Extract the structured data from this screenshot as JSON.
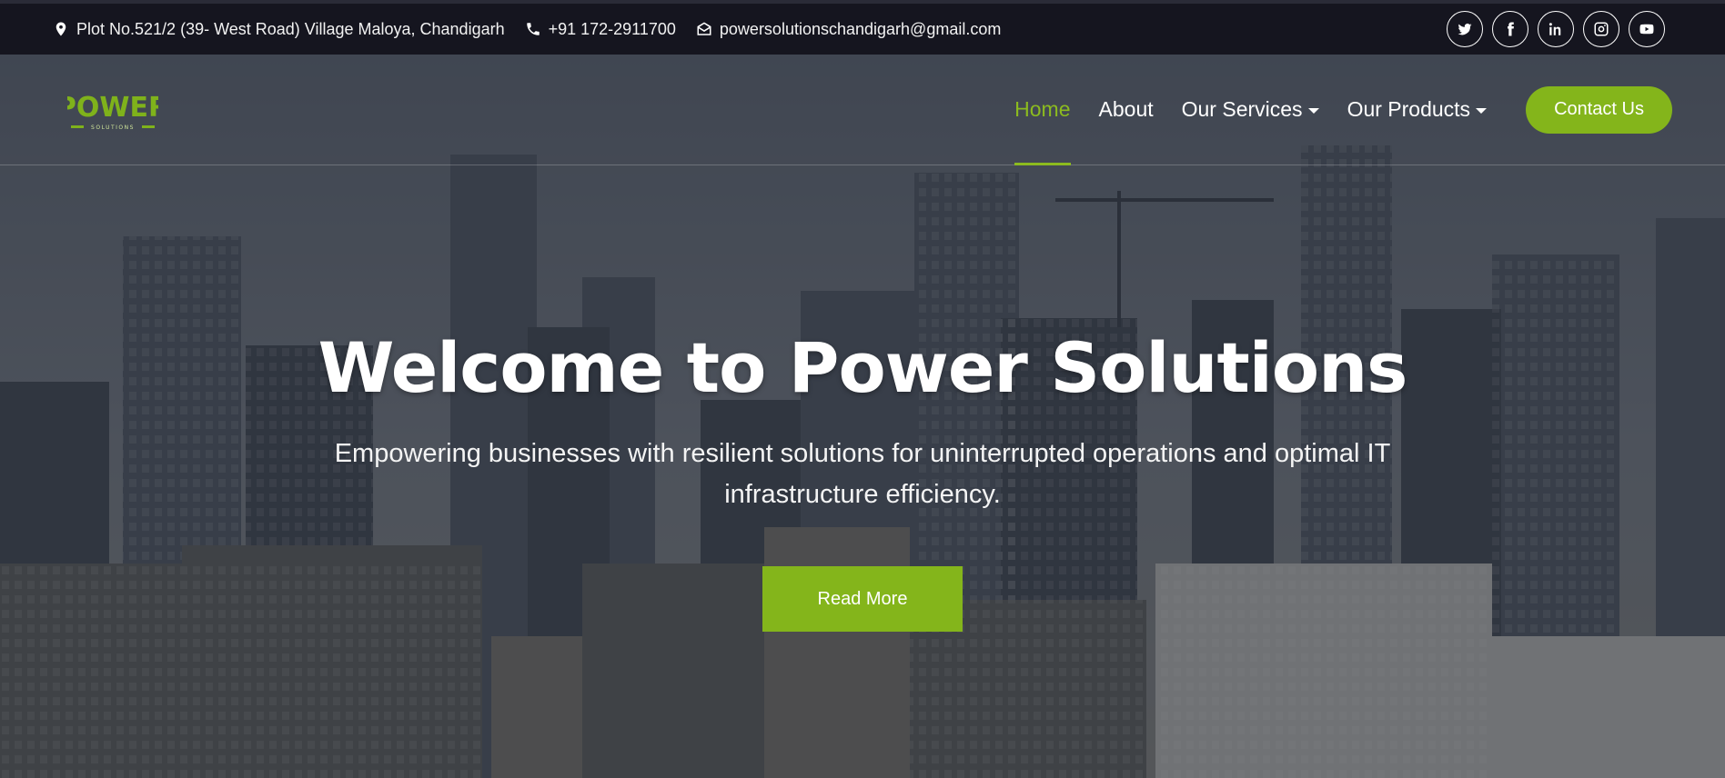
{
  "topbar": {
    "address": "Plot No.521/2 (39- West Road) Village Maloya, Chandigarh",
    "phone": "+91 172-2911700",
    "email": "powersolutionschandigarh@gmail.com",
    "icons": [
      "map-pin-icon",
      "phone-icon",
      "envelope-open-icon"
    ],
    "socials": [
      "twitter-icon",
      "facebook-icon",
      "linkedin-icon",
      "instagram-icon",
      "youtube-icon"
    ]
  },
  "logo": {
    "line1": "POWER",
    "line2": "SOLUTIONS"
  },
  "nav": {
    "items": [
      {
        "label": "Home",
        "active": true
      },
      {
        "label": "About"
      },
      {
        "label": "Our Services",
        "dropdown": true
      },
      {
        "label": "Our Products",
        "dropdown": true
      }
    ],
    "contact_label": "Contact Us"
  },
  "hero": {
    "title": "Welcome to Power Solutions",
    "subtitle": "Empowering businesses with resilient solutions for uninterrupted operations and optimal IT infrastructure efficiency.",
    "cta_label": "Read More"
  },
  "colors": {
    "accent": "#84b51b",
    "topbar": "#15151f",
    "overlay": "#1c202c"
  }
}
